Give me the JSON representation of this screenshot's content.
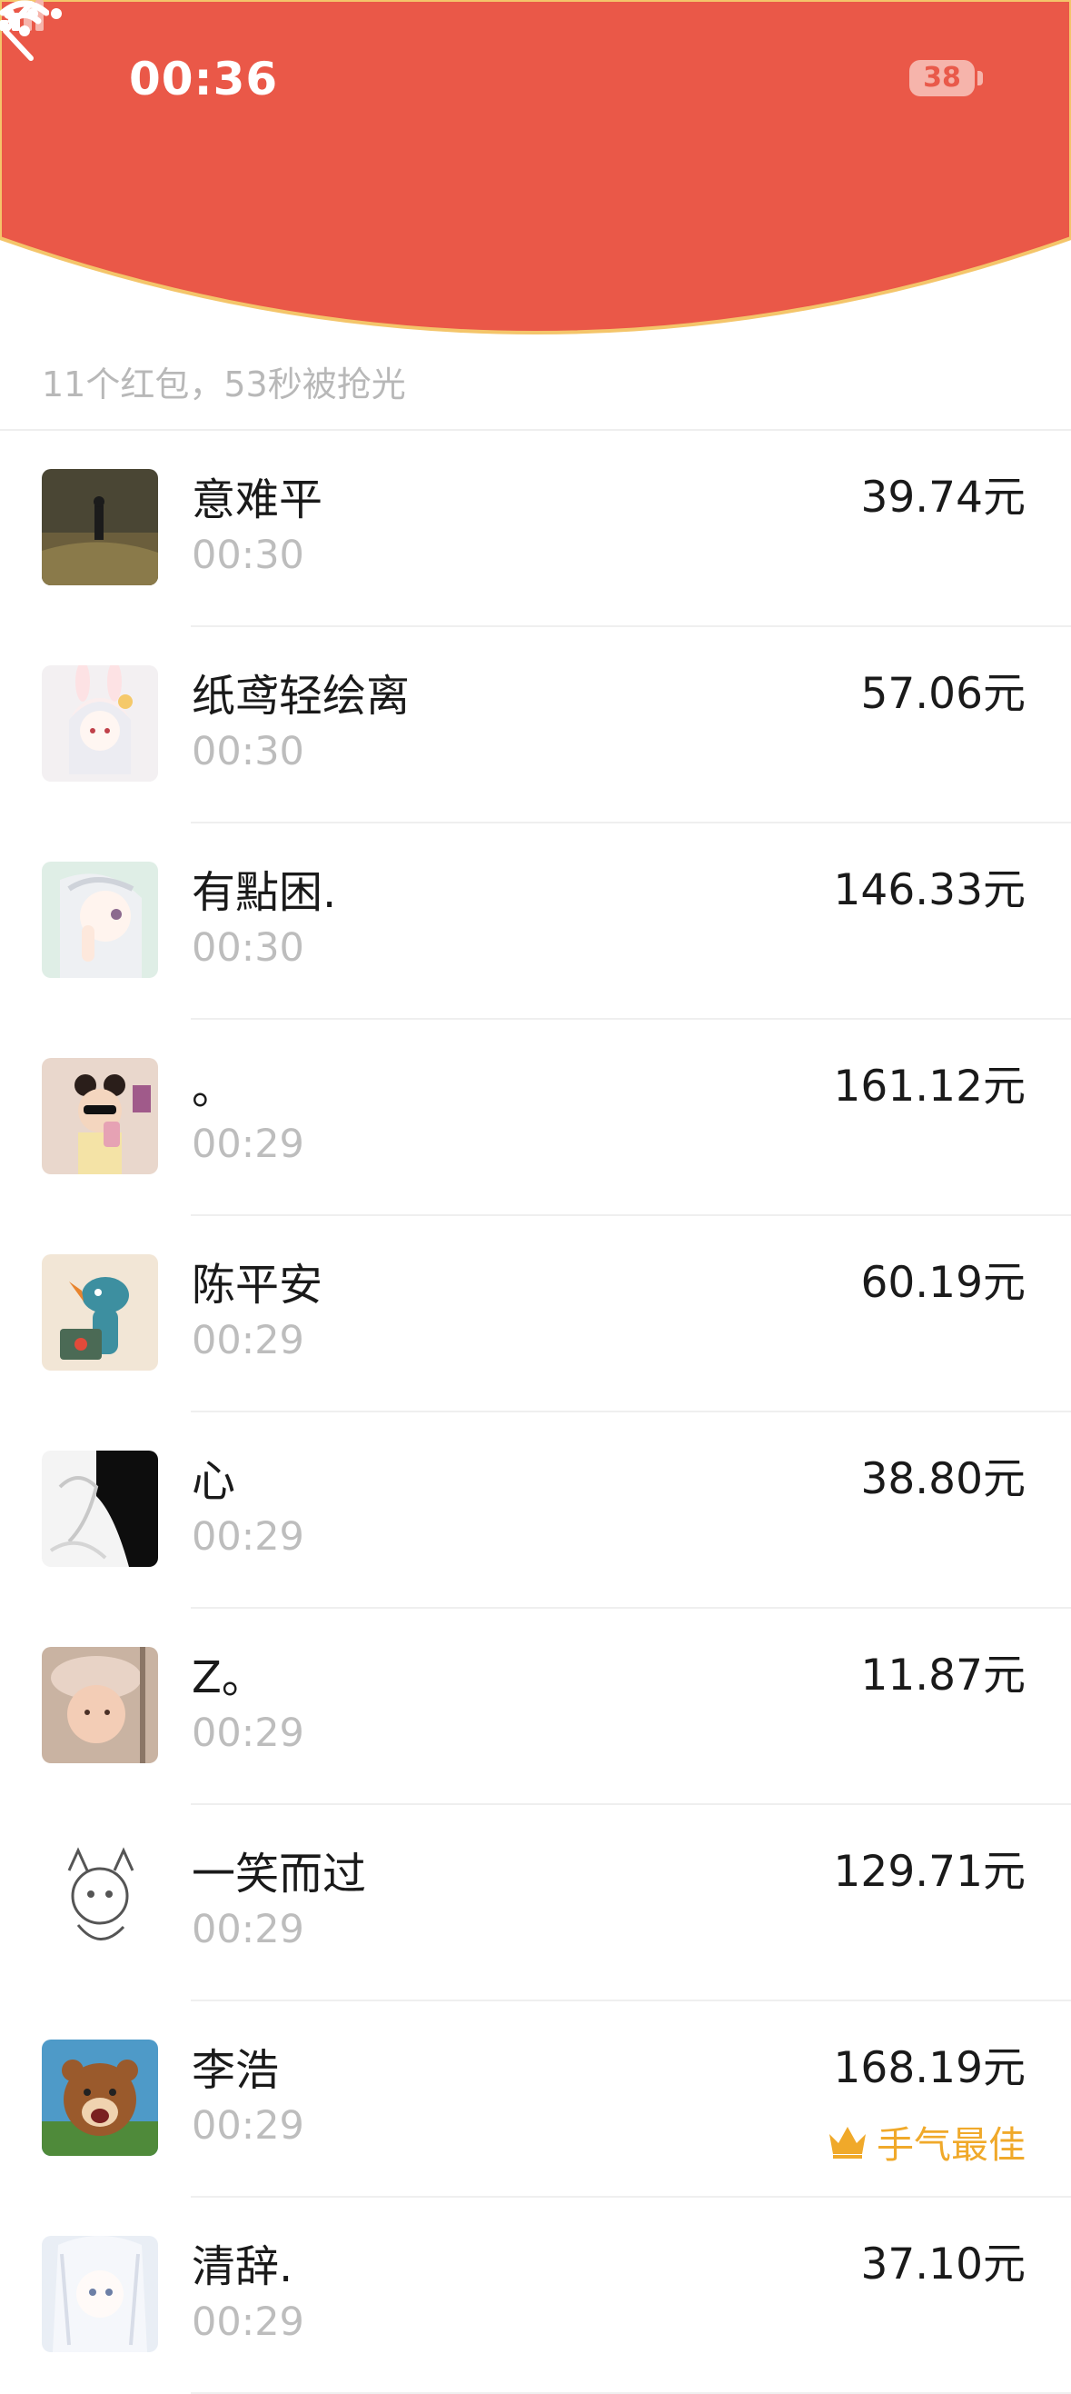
{
  "status_bar": {
    "time": "00:36",
    "battery": "38"
  },
  "header": {
    "color": "#ea5848",
    "edge_color": "#f4c56a"
  },
  "summary": "11个红包，53秒被抢光",
  "best_label": "手气最佳",
  "records": [
    {
      "name": "意难平",
      "time": "00:30",
      "amount": "39.74元",
      "avatar": "landscape-figure"
    },
    {
      "name": "纸鸢轻绘离",
      "time": "00:30",
      "amount": "57.06元",
      "avatar": "anime-bunny-girl"
    },
    {
      "name": "有點困.",
      "time": "00:30",
      "amount": "146.33元",
      "avatar": "anime-white-hair"
    },
    {
      "name": "。",
      "time": "00:29",
      "amount": "161.12元",
      "avatar": "girl-sunglasses"
    },
    {
      "name": "陈平安",
      "time": "00:29",
      "amount": "60.19元",
      "avatar": "blue-pokemon"
    },
    {
      "name": "心",
      "time": "00:29",
      "amount": "38.80元",
      "avatar": "sketch-couple"
    },
    {
      "name": "Z。",
      "time": "00:29",
      "amount": "11.87元",
      "avatar": "baby-hat"
    },
    {
      "name": "一笑而过",
      "time": "00:29",
      "amount": "129.71元",
      "avatar": "line-sketch-cat"
    },
    {
      "name": "李浩",
      "time": "00:29",
      "amount": "168.19元",
      "avatar": "cartoon-bear",
      "best": true
    },
    {
      "name": "清辞.",
      "time": "00:29",
      "amount": "37.10元",
      "avatar": "anime-silver-hair"
    }
  ]
}
